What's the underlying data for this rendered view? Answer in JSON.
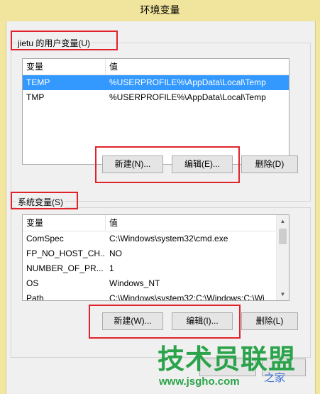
{
  "window": {
    "title": "环境变量"
  },
  "user_vars": {
    "label": "jietu 的用户变量(U)",
    "columns": [
      "变量",
      "值"
    ],
    "rows": [
      {
        "name": "TEMP",
        "value": "%USERPROFILE%\\AppData\\Local\\Temp",
        "selected": true
      },
      {
        "name": "TMP",
        "value": "%USERPROFILE%\\AppData\\Local\\Temp",
        "selected": false
      }
    ],
    "buttons": {
      "new": "新建(N)...",
      "edit": "编辑(E)...",
      "delete": "删除(D)"
    }
  },
  "system_vars": {
    "label": "系统变量(S)",
    "columns": [
      "变量",
      "值"
    ],
    "rows": [
      {
        "name": "ComSpec",
        "value": "C:\\Windows\\system32\\cmd.exe"
      },
      {
        "name": "FP_NO_HOST_CH...",
        "value": "NO"
      },
      {
        "name": "NUMBER_OF_PR...",
        "value": "1"
      },
      {
        "name": "OS",
        "value": "Windows_NT"
      },
      {
        "name": "Path",
        "value": "C:\\Windows\\system32;C:\\Windows;C:\\Wi"
      }
    ],
    "buttons": {
      "new": "新建(W)...",
      "edit": "编辑(I)...",
      "delete": "删除(L)"
    }
  },
  "watermark": {
    "logo": "技术员联盟",
    "site": "www.jsgho.com",
    "sub": "之家"
  },
  "colors": {
    "selection": "#3399ff",
    "highlight_box": "#e0232a",
    "titlebar": "#f1e49c",
    "watermark_green": "#2aa34a"
  }
}
